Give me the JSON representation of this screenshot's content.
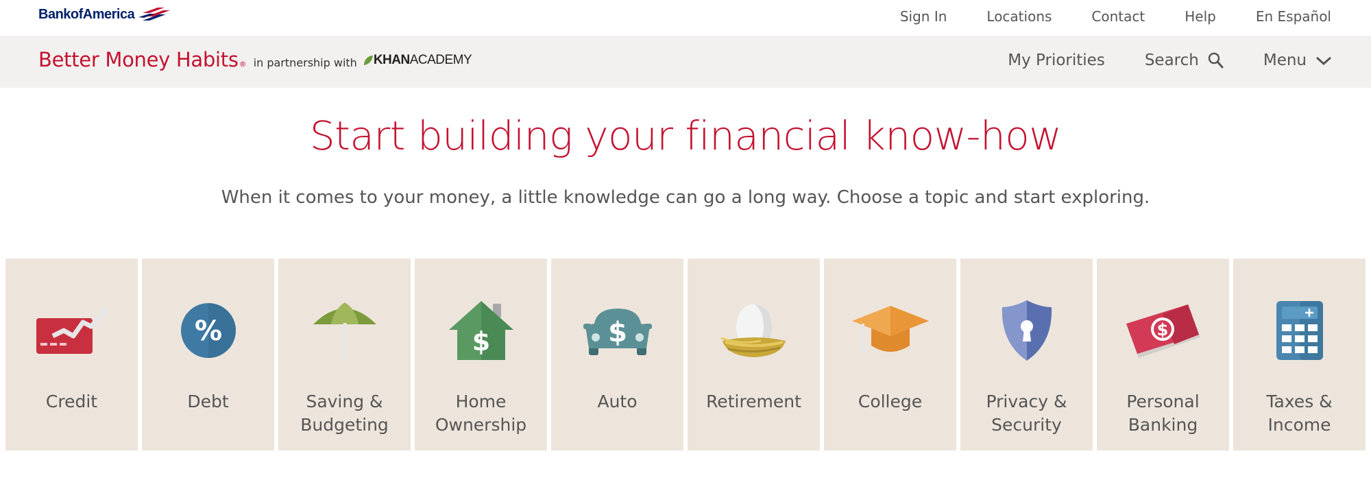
{
  "header": {
    "logo_text": "BankofAmerica",
    "links": [
      {
        "label": "Sign In"
      },
      {
        "label": "Locations"
      },
      {
        "label": "Contact"
      },
      {
        "label": "Help"
      },
      {
        "label": "En Español"
      }
    ]
  },
  "brand": {
    "title": "Better Money Habits",
    "registered": "®",
    "partner_text": "in partnership with",
    "khan_bold": "KHAN",
    "khan_rest": "ACADEMY",
    "nav": {
      "priorities": "My Priorities",
      "search": "Search",
      "menu": "Menu"
    }
  },
  "hero": {
    "title": "Start building your financial know-how",
    "subtitle": "When it comes to your money, a little knowledge can go a long way. Choose a topic and start exploring."
  },
  "topics": [
    {
      "line1": "Credit",
      "line2": "",
      "icon": "credit-card-icon"
    },
    {
      "line1": "Debt",
      "line2": "",
      "icon": "percent-icon"
    },
    {
      "line1": "Saving &",
      "line2": "Budgeting",
      "icon": "umbrella-icon"
    },
    {
      "line1": "Home",
      "line2": "Ownership",
      "icon": "house-icon"
    },
    {
      "line1": "Auto",
      "line2": "",
      "icon": "car-icon"
    },
    {
      "line1": "Retirement",
      "line2": "",
      "icon": "nest-egg-icon"
    },
    {
      "line1": "College",
      "line2": "",
      "icon": "graduation-cap-icon"
    },
    {
      "line1": "Privacy &",
      "line2": "Security",
      "icon": "shield-lock-icon"
    },
    {
      "line1": "Personal",
      "line2": "Banking",
      "icon": "money-bill-icon"
    },
    {
      "line1": "Taxes &",
      "line2": "Income",
      "icon": "calculator-icon"
    }
  ],
  "colors": {
    "brand_red": "#c41230",
    "boa_navy": "#012169",
    "tile_bg": "#ede5dc",
    "brand_bar_bg": "#f2f1ef"
  }
}
